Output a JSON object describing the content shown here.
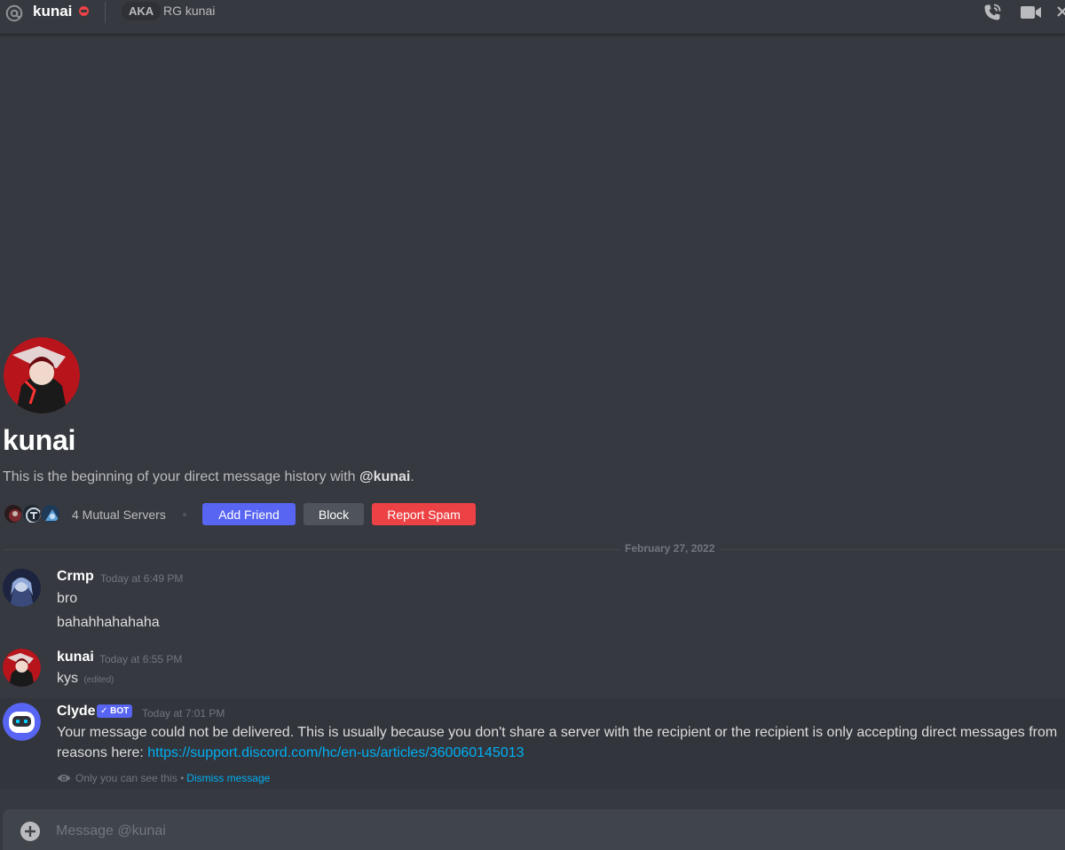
{
  "header": {
    "name": "kunai",
    "aka_label": "AKA",
    "aka_name": "RG kunai",
    "icons": [
      "at-icon",
      "dnd-status-icon",
      "phone-call-icon",
      "video-call-icon",
      "close-icon"
    ]
  },
  "intro": {
    "name": "kunai",
    "description_prefix": "This is the beginning of your direct message history with ",
    "description_mention": "@kunai",
    "description_suffix": ".",
    "mutual_servers": "4 Mutual Servers",
    "buttons": {
      "add_friend": "Add Friend",
      "block": "Block",
      "report_spam": "Report Spam"
    }
  },
  "date_divider": "February 27, 2022",
  "messages": [
    {
      "author": "Crmp",
      "time": "Today at 6:49 PM",
      "lines": [
        "bro",
        "bahahhahahaha"
      ]
    },
    {
      "author": "kunai",
      "time": "Today at 6:55 PM",
      "lines": [
        "kys"
      ],
      "edited": "(edited)"
    },
    {
      "author": "Clyde",
      "tag": "✓ BOT",
      "time": "Today at 7:01 PM",
      "text_line1": "Your message could not be delivered. This is usually because you don't share a server with the recipient or the recipient is only accepting direct messages from",
      "text_line2_prefix": "reasons here: ",
      "link": "https://support.discord.com/hc/en-us/articles/360060145013",
      "only_you": "Only you can see this",
      "separator": "•",
      "dismiss": "Dismiss message"
    }
  ],
  "composer": {
    "placeholder": "Message @kunai"
  },
  "colors": {
    "background": "#36393f",
    "blurple": "#5865f2",
    "red": "#ed4245",
    "link": "#00aff4"
  }
}
